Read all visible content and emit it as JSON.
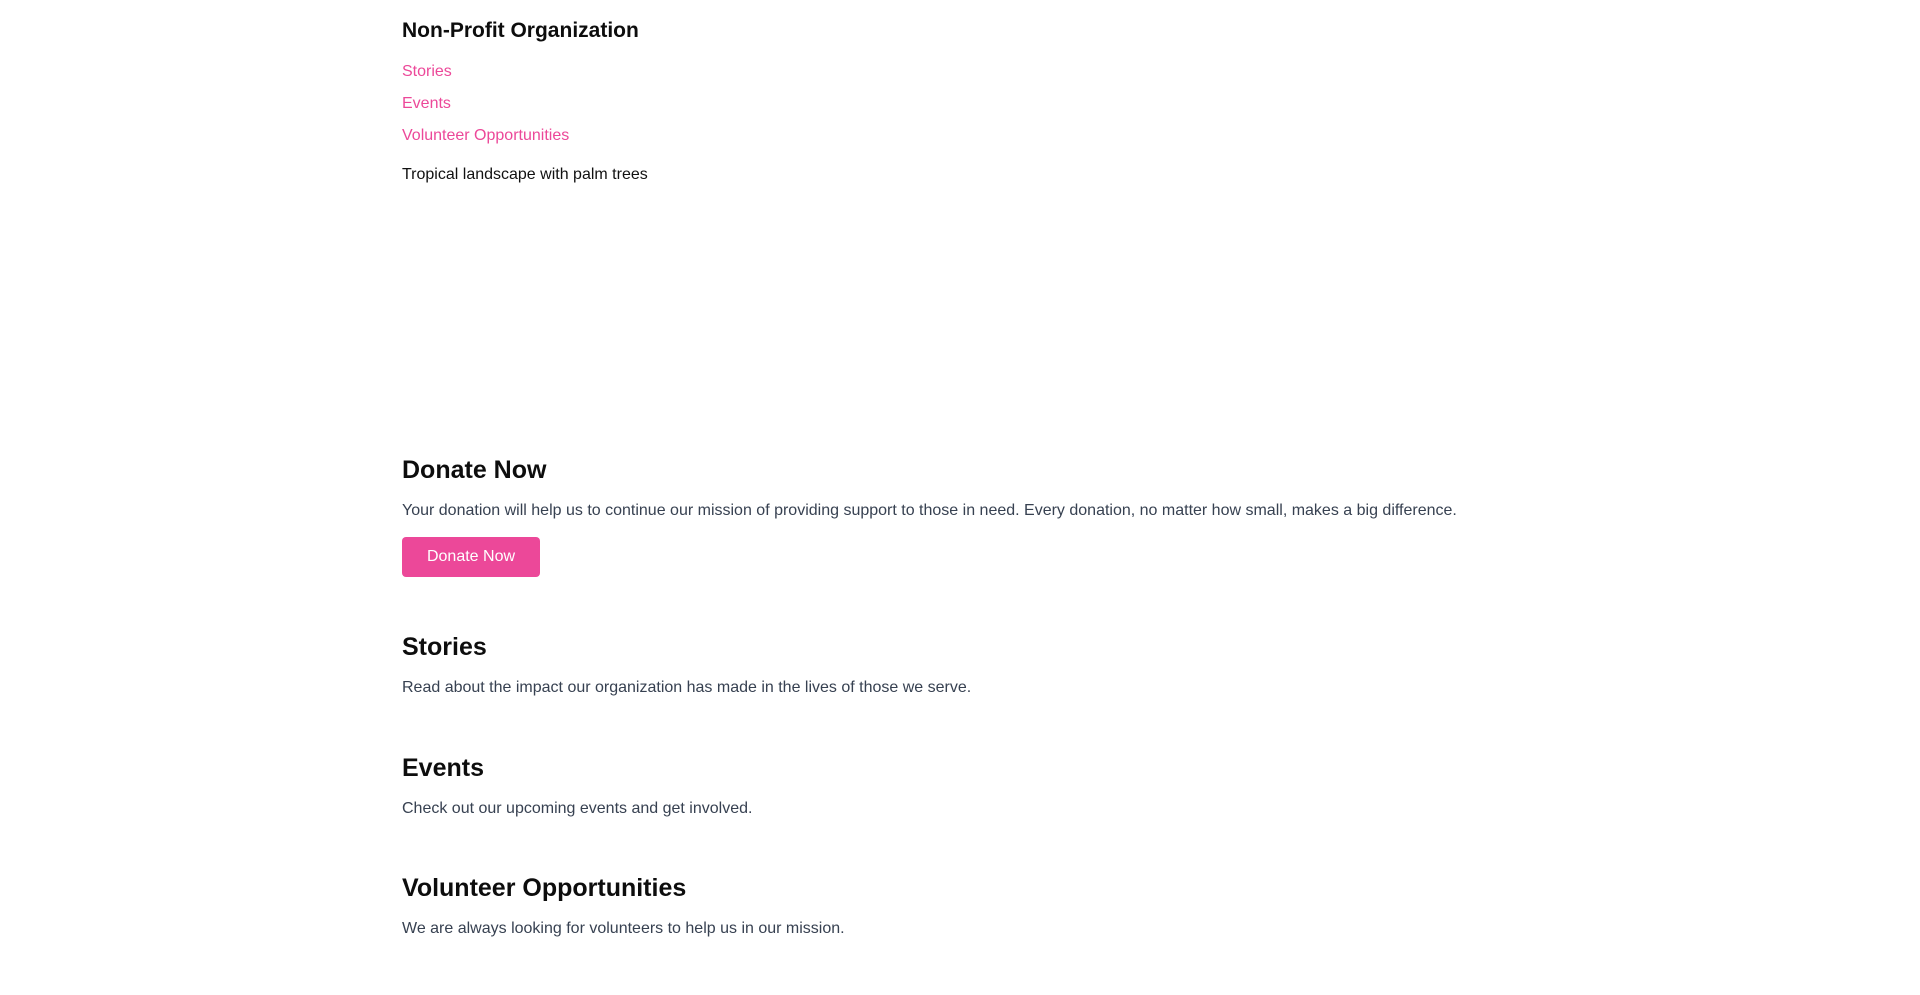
{
  "header": {
    "title": "Non-Profit Organization",
    "nav": [
      {
        "label": "Stories"
      },
      {
        "label": "Events"
      },
      {
        "label": "Volunteer Opportunities"
      }
    ]
  },
  "hero": {
    "alt_text": "Tropical landscape with palm trees"
  },
  "donate": {
    "title": "Donate Now",
    "text": "Your donation will help us to continue our mission of providing support to those in need. Every donation, no matter how small, makes a big difference.",
    "button_label": "Donate Now"
  },
  "stories": {
    "title": "Stories",
    "text": "Read about the impact our organization has made in the lives of those we serve."
  },
  "events": {
    "title": "Events",
    "text": "Check out our upcoming events and get involved."
  },
  "volunteer": {
    "title": "Volunteer Opportunities",
    "text": "We are always looking for volunteers to help us in our mission."
  },
  "colors": {
    "accent": "#ec4899",
    "heading": "#0d0d0d",
    "body_text": "#374151",
    "background": "#ffffff"
  }
}
